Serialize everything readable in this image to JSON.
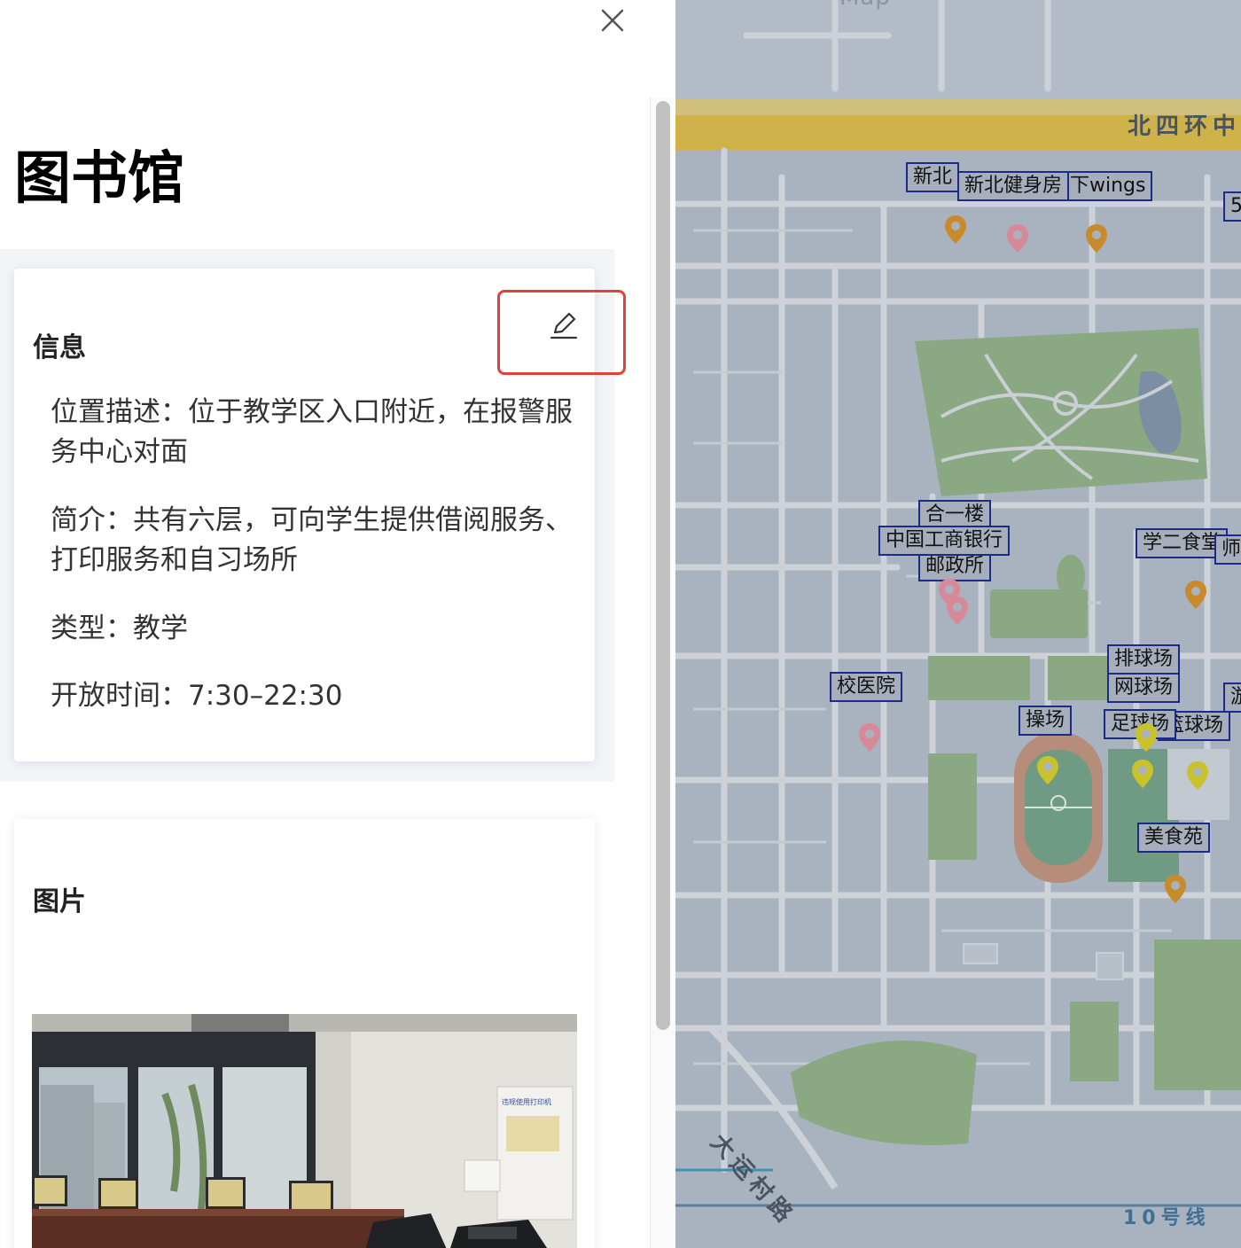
{
  "panel": {
    "title": "图书馆",
    "info_card": {
      "heading": "信息",
      "location": "位置描述：位于教学区入口附近，在报警服务中心对面",
      "intro": "简介：共有六层，可向学生提供借阅服务、打印服务和自习场所",
      "type": "类型：教学",
      "hours": "开放时间：7:30–22:30"
    },
    "photo_card": {
      "heading": "图片",
      "photo_sign_text": "违规使用打印机"
    }
  },
  "icons": {
    "close": "close-icon",
    "edit": "pencil-edit-icon"
  },
  "map": {
    "top_label": "Map",
    "road_north": "北四环中",
    "road_southwest": "大运村路",
    "metro_line": "10号线",
    "labels": {
      "xinbei": "新北",
      "xinbei_gym": "新北健身房",
      "wings": "地下wings",
      "five": "5",
      "he_yi": "合一楼",
      "icbc": "中国工商银行",
      "post": "邮政所",
      "xue_er": "学二食堂",
      "shi": "师",
      "hospital": "校医院",
      "volleyball": "排球场",
      "tennis": "网球场",
      "playground": "操场",
      "football": "足球场",
      "basketball": "篮球场",
      "you": "游",
      "meishiyuan": "美食苑"
    }
  },
  "colors": {
    "highlight_box": "#e0413a",
    "map_label_border": "#1c2a8a",
    "pin_orange": "#c98a2b",
    "pin_pink": "#d7899a",
    "pin_yellow": "#c9c22a",
    "ring_road": "#cfb24a",
    "greenery": "#8aa882"
  }
}
